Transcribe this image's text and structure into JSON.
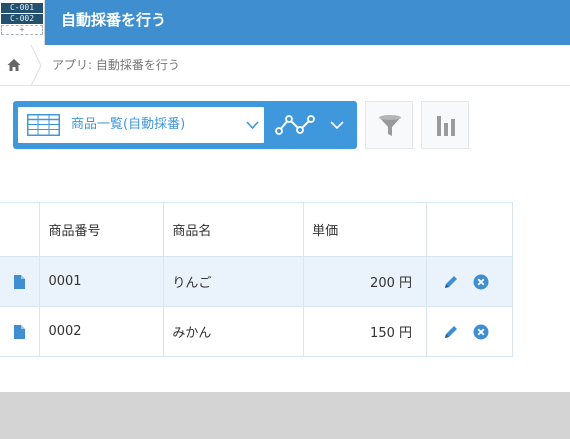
{
  "header": {
    "app_icon_lines": [
      "C-001",
      "C-002",
      "+"
    ],
    "title": "自動採番を行う"
  },
  "breadcrumb": {
    "label": "アプリ: 自動採番を行う"
  },
  "toolbar": {
    "view_name": "商品一覧(自動採番)"
  },
  "table": {
    "columns": [
      "商品番号",
      "商品名",
      "単価"
    ],
    "rows": [
      {
        "code": "0001",
        "name": "りんご",
        "price": "200 円"
      },
      {
        "code": "0002",
        "name": "みかん",
        "price": "150 円"
      }
    ]
  },
  "colors": {
    "header": "#3f8fd0",
    "accent": "#3f98db",
    "row_highlight": "#eaf3fb",
    "footer_band": "#d4d4d4"
  },
  "icons": [
    "home-icon",
    "table-icon",
    "chevron-down-icon",
    "line-graph-icon",
    "filter-icon",
    "bar-chart-icon",
    "record-document-icon",
    "edit-pencil-icon",
    "delete-circle-icon"
  ]
}
